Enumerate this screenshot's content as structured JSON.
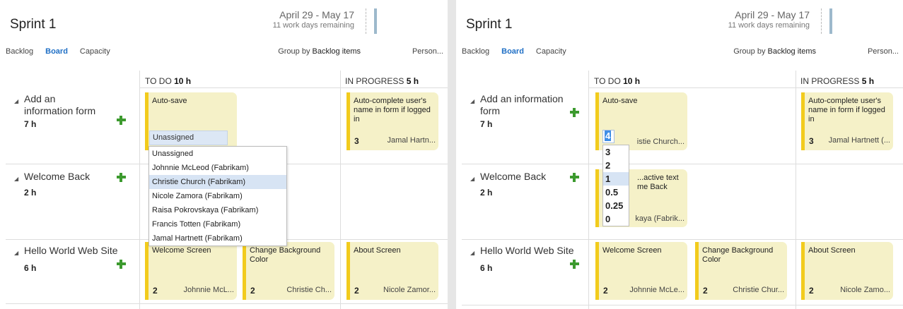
{
  "panels": [
    {
      "sprint_title": "Sprint 1",
      "date_range": "April 29 - May 17",
      "days_remaining": "11 work days remaining",
      "tabs": [
        "Backlog",
        "Board",
        "Capacity"
      ],
      "group_by_label": "Group by",
      "group_by_value": "Backlog items",
      "person_label": "Person...",
      "columns": [
        {
          "name": "TO DO",
          "hours": "10 h"
        },
        {
          "name": "IN PROGRESS",
          "hours": "5 h"
        }
      ],
      "rows": [
        {
          "title": "Add an information form",
          "hours": "7 h"
        },
        {
          "title": "Welcome Back",
          "hours": "2 h"
        },
        {
          "title": "Hello World Web Site",
          "hours": "6 h"
        }
      ],
      "cards": {
        "autosave": {
          "title": "Auto-save"
        },
        "autocomplete": {
          "title": "Auto-complete user's name in form if logged in",
          "estimate": "3",
          "owner": "Jamal Hartn..."
        },
        "welcome_screen": {
          "title": "Welcome Screen",
          "estimate": "2",
          "owner": "Johnnie McL..."
        },
        "change_bg": {
          "title": "Change Background Color",
          "estimate": "2",
          "owner": "Christie Ch..."
        },
        "about": {
          "title": "About Screen",
          "estimate": "2",
          "owner": "Nicole Zamor..."
        }
      },
      "assign_dropdown": {
        "current": "Unassigned",
        "options": [
          "Unassigned",
          "Johnnie McLeod (Fabrikam)",
          "Christie Church (Fabrikam)",
          "Nicole Zamora (Fabrikam)",
          "Raisa Pokrovskaya (Fabrikam)",
          "Francis Totten (Fabrikam)",
          "Jamal Hartnett (Fabrikam)"
        ],
        "highlighted": "Christie Church (Fabrikam)"
      }
    },
    {
      "sprint_title": "Sprint 1",
      "date_range": "April 29 - May 17",
      "days_remaining": "11 work days remaining",
      "tabs": [
        "Backlog",
        "Board",
        "Capacity"
      ],
      "group_by_label": "Group by",
      "group_by_value": "Backlog items",
      "person_label": "Person...",
      "columns": [
        {
          "name": "TO DO",
          "hours": "10 h"
        },
        {
          "name": "IN PROGRESS",
          "hours": "5 h"
        }
      ],
      "rows": [
        {
          "title": "Add an information form",
          "hours": "7 h"
        },
        {
          "title": "Welcome Back",
          "hours": "2 h"
        },
        {
          "title": "Hello World Web Site",
          "hours": "6 h"
        }
      ],
      "cards": {
        "autosave": {
          "title": "Auto-save",
          "owner": "istie Church..."
        },
        "autocomplete": {
          "title": "Auto-complete user's name in form if logged in",
          "estimate": "3",
          "owner": "Jamal Hartnett (..."
        },
        "welcome_back_card": {
          "title": "...active text me Back",
          "owner": "kaya (Fabrik..."
        },
        "welcome_screen": {
          "title": "Welcome Screen",
          "estimate": "2",
          "owner": "Johnnie McLe..."
        },
        "change_bg": {
          "title": "Change Background Color",
          "estimate": "2",
          "owner": "Christie Chur..."
        },
        "about": {
          "title": "About Screen",
          "estimate": "2",
          "owner": "Nicole Zamo..."
        }
      },
      "estimate_dropdown": {
        "current": "4",
        "options": [
          "3",
          "2",
          "1",
          "0.5",
          "0.25",
          "0"
        ],
        "highlighted": "1"
      }
    }
  ],
  "colors": {
    "accent": "#1f6fc5",
    "card_bg": "#f5f1c8",
    "card_border": "#f2cb1d",
    "plus": "#3c9a2e"
  }
}
